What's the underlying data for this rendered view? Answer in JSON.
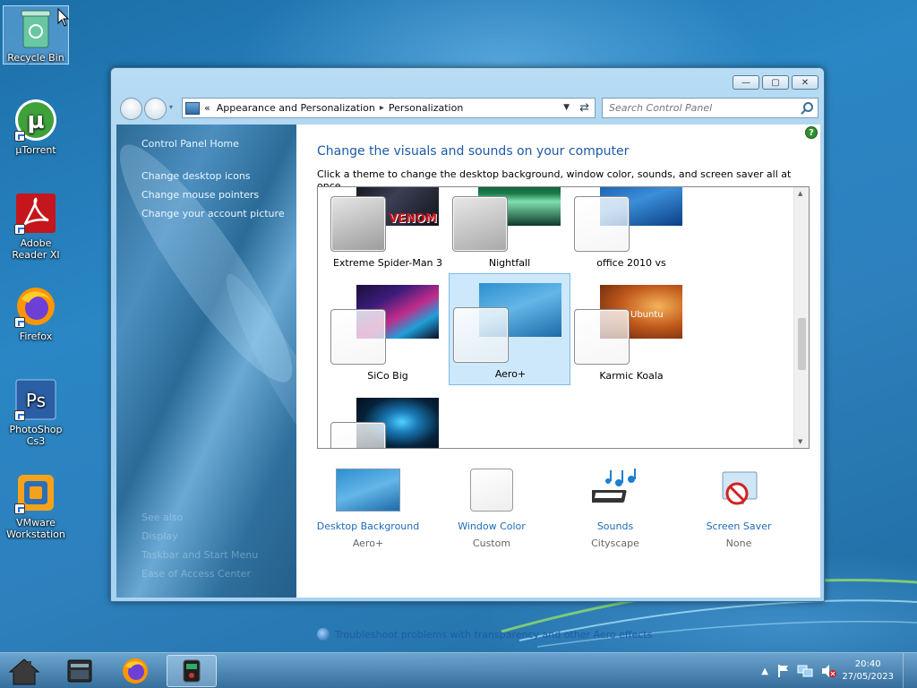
{
  "desktop": {
    "icons": [
      {
        "label": "Recycle Bin"
      },
      {
        "label": "µTorrent"
      },
      {
        "label": "Adobe Reader XI"
      },
      {
        "label": "Firefox"
      },
      {
        "label": "PhotoShop Cs3"
      },
      {
        "label": "VMware Workstation"
      }
    ]
  },
  "window": {
    "controls": {
      "minimize": "—",
      "maximize": "▢",
      "close": "✕"
    },
    "address": {
      "prefix": "«",
      "crumbs": [
        "Appearance and Personalization",
        "Personalization"
      ],
      "separator": "▸"
    },
    "search": {
      "placeholder": "Search Control Panel"
    },
    "sidebar": {
      "home": "Control Panel Home",
      "links": [
        "Change desktop icons",
        "Change mouse pointers",
        "Change your account picture"
      ],
      "see_also_title": "See also",
      "see_also": [
        "Display",
        "Taskbar and Start Menu",
        "Ease of Access Center"
      ]
    },
    "content": {
      "help": "?",
      "heading": "Change the visuals and sounds on your computer",
      "subtext": "Click a theme to change the desktop background, window color, sounds, and screen saver all at once.",
      "themes": [
        {
          "name": "Extreme Spider-Man 3",
          "selected": false,
          "wall_text": "VENOM"
        },
        {
          "name": "Nightfall",
          "selected": false
        },
        {
          "name": "office 2010 vs",
          "selected": false
        },
        {
          "name": "SiCo Big",
          "selected": false
        },
        {
          "name": "Aero+",
          "selected": true
        },
        {
          "name": "Karmic Koala",
          "selected": false,
          "wall_text": "Ubuntu"
        },
        {
          "name": "",
          "selected": false
        }
      ],
      "options": [
        {
          "title": "Desktop Background",
          "value": "Aero+"
        },
        {
          "title": "Window Color",
          "value": "Custom"
        },
        {
          "title": "Sounds",
          "value": "Cityscape"
        },
        {
          "title": "Screen Saver",
          "value": "None"
        }
      ],
      "troubleshoot": "Troubleshoot problems with transparency and other Aero effects"
    }
  },
  "taskbar": {
    "clock_time": "20:40",
    "clock_date": "27/05/2023"
  }
}
